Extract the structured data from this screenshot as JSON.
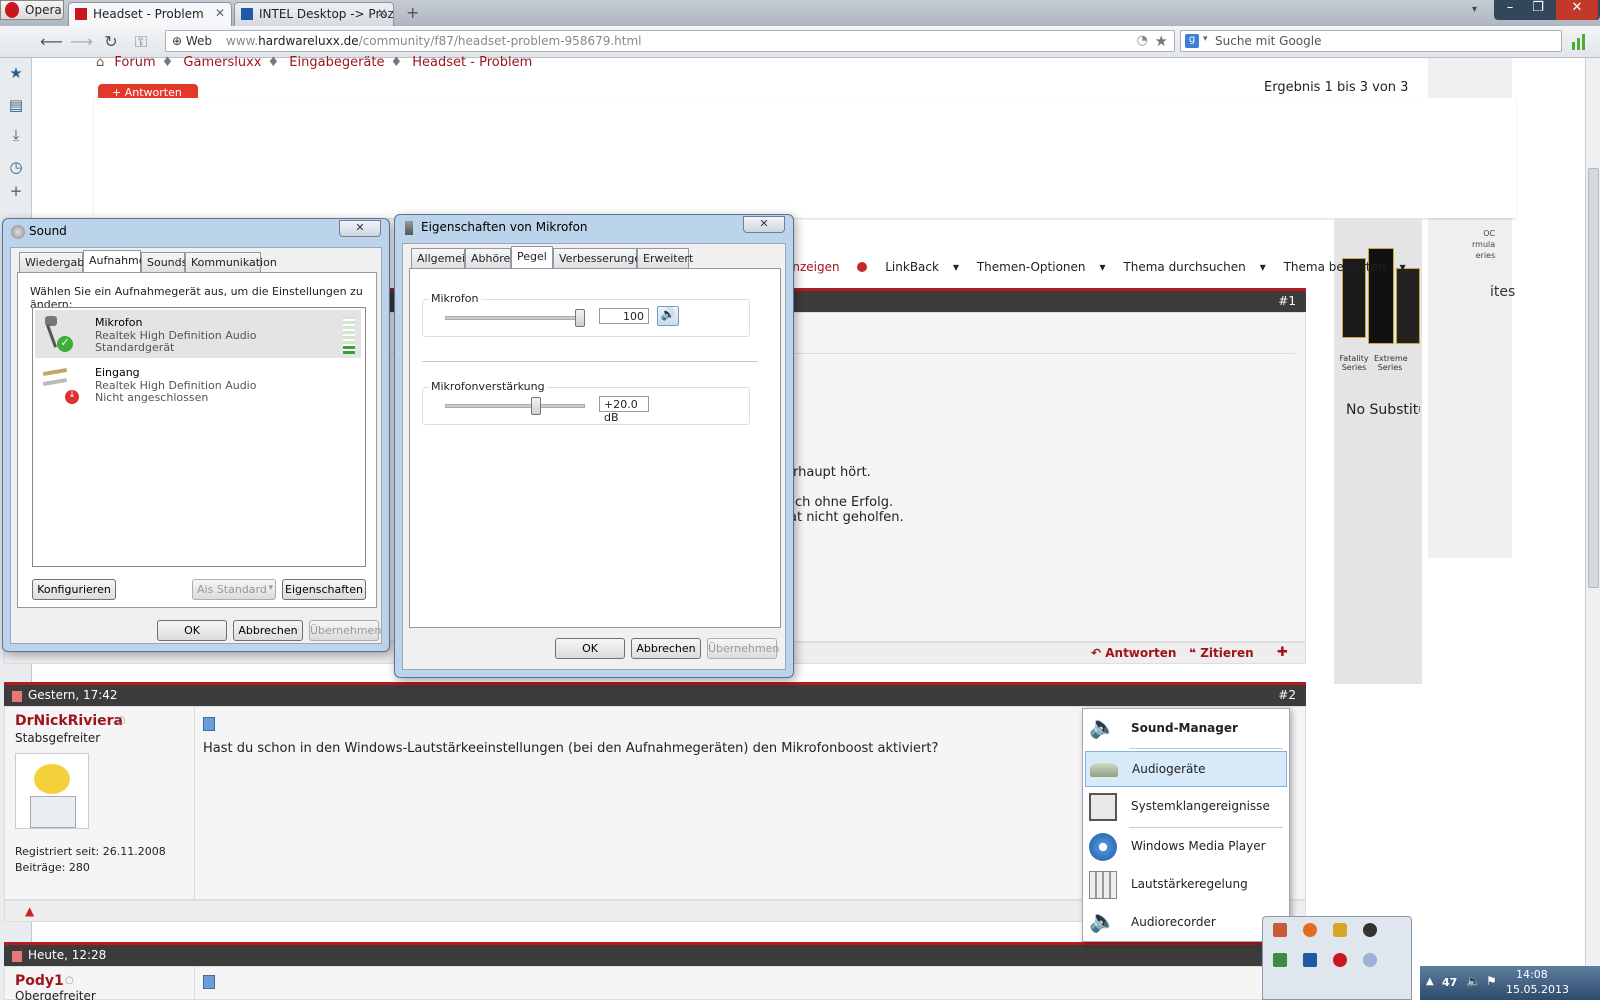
{
  "browser": {
    "menu_label": "Opera",
    "tabs": [
      {
        "label": "Headset - Problem"
      },
      {
        "label": "INTEL Desktop -> Proz..."
      }
    ],
    "address_scheme_label": "Web",
    "url_prefix": "www.",
    "url_domain": "hardwareluxx.de",
    "url_path": "/community/f87/headset-problem-958679.html",
    "search_placeholder": "Suche mit Google"
  },
  "page": {
    "breadcrumb": [
      "Forum",
      "Gamersluxx",
      "Eingabegeräte",
      "Headset - Problem"
    ],
    "reply_button": "Antworten",
    "result_count": "Ergebnis 1 bis 3 von 3",
    "options": {
      "anzeigen": "anzeigen",
      "linkback": "LinkBack",
      "themen": "Themen-Optionen",
      "durchsuchen": "Thema durchsuchen",
      "bewerten": "Thema bewerten"
    },
    "post1": {
      "number": "#1",
      "fragment1": "erhaupt hört.",
      "fragment2": "och ohne Erfolg.",
      "fragment3": "at nicht geholfen.",
      "actions": {
        "reply": "Antworten",
        "quote": "Zitieren"
      }
    },
    "post2": {
      "date": "Gestern, 17:42",
      "number": "#2",
      "username": "DrNickRiviera",
      "rank": "Stabsgefreiter",
      "registered": "Registriert seit: 26.11.2008",
      "posts": "Beiträge: 280",
      "text": "Hast du schon in den Windows-Lautstärkeeinstellungen (bei den Aufnahmegeräten) den Mikrofonboost aktiviert?"
    },
    "post3": {
      "date": "Heute, 12:28",
      "username": "Pody1",
      "rank": "Obergefreiter"
    },
    "ad": {
      "series": [
        "Fatality Series",
        "Extreme Series"
      ],
      "no_subst": "No Substitut"
    }
  },
  "sound_dialog": {
    "title": "Sound",
    "tabs": [
      "Wiedergabe",
      "Aufnahme",
      "Sounds",
      "Kommunikation"
    ],
    "selected_tab": "Aufnahme",
    "instruction": "Wählen Sie ein Aufnahmegerät aus, um die Einstellungen zu ändern:",
    "devices": [
      {
        "name": "Mikrofon",
        "driver": "Realtek High Definition Audio",
        "status": "Standardgerät"
      },
      {
        "name": "Eingang",
        "driver": "Realtek High Definition Audio",
        "status": "Nicht angeschlossen"
      }
    ],
    "configure": "Konfigurieren",
    "set_default": "Als Standard",
    "properties": "Eigenschaften",
    "ok": "OK",
    "cancel": "Abbrechen",
    "apply": "Übernehmen"
  },
  "mic_dialog": {
    "title": "Eigenschaften von Mikrofon",
    "tabs": [
      "Allgemein",
      "Abhören",
      "Pegel",
      "Verbesserungen",
      "Erweitert"
    ],
    "selected_tab": "Pegel",
    "mic_label": "Mikrofon",
    "mic_value": "100",
    "mic_level_fraction": 1.0,
    "boost_label": "Mikrofonverstärkung",
    "boost_value": "+20.0 dB",
    "boost_level_fraction": 0.66,
    "ok": "OK",
    "cancel": "Abbrechen",
    "apply": "Übernehmen"
  },
  "sound_manager": {
    "title": "Sound-Manager",
    "items": [
      "Audiogeräte",
      "Systemklangereignisse",
      "Windows Media Player",
      "Lautstärkeregelung",
      "Audiorecorder"
    ],
    "highlighted": "Audiogeräte"
  },
  "taskbar": {
    "lang": "47",
    "time": "14:08",
    "date": "15.05.2013"
  },
  "colors": {
    "brand_red": "#a0151b",
    "post_bar": "#3c3c3c",
    "dialog_frame": "#bcd3ec"
  }
}
